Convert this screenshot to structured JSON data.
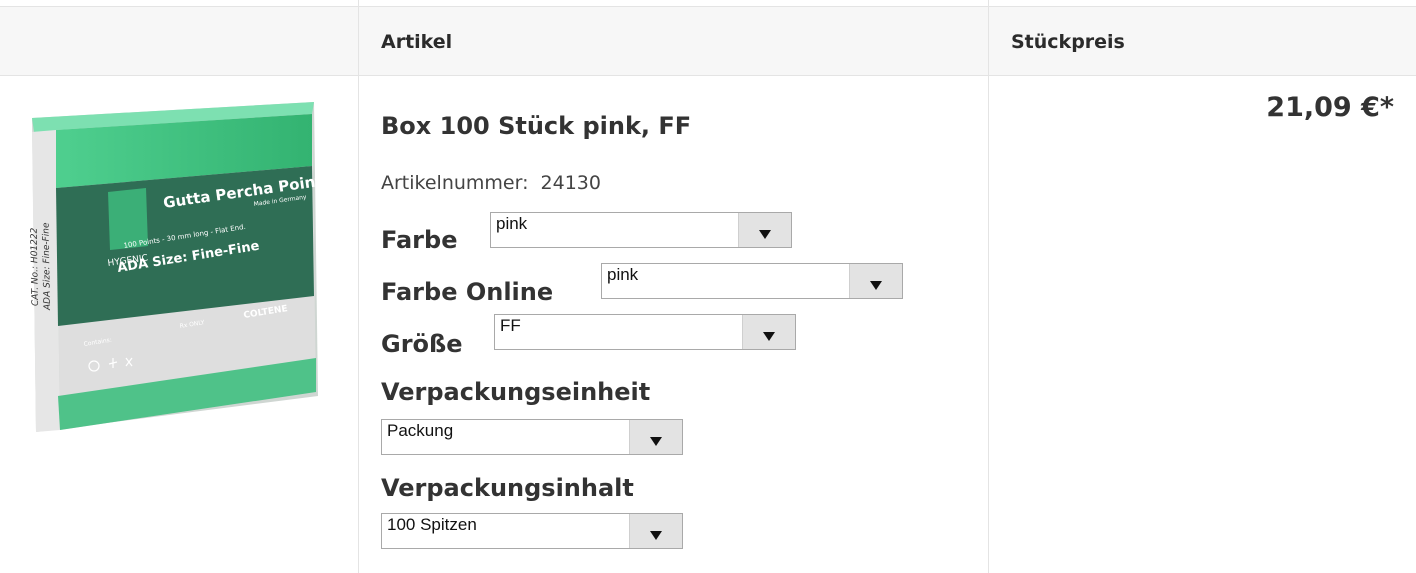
{
  "table": {
    "col_article": "Artikel",
    "col_price": "Stückpreis"
  },
  "product": {
    "image_label": {
      "brand": "HYGENIC",
      "name": "Gutta Percha Points",
      "made_in": "Made in Germany",
      "spec": "100 Points - 30 mm long - Flat End.",
      "size": "ADA Size: Fine-Fine",
      "cat": "CAT. No.: H01222",
      "side_size": "ADA Size: Fine-Fine",
      "rx": "Rx ONLY",
      "maker": "COLTENE",
      "contains": "Contains:"
    },
    "title": "Box 100 Stück pink, FF",
    "artnr_label": "Artikelnummer:",
    "artnr_value": "24130",
    "price": "21,09 €*"
  },
  "options": {
    "farbe": {
      "label": "Farbe",
      "value": "pink"
    },
    "farbe_online": {
      "label": "Farbe Online",
      "value": "pink"
    },
    "groesse": {
      "label": "Größe",
      "value": "FF"
    },
    "verpackungseinheit": {
      "label": "Verpackungseinheit",
      "value": "Packung"
    },
    "verpackungsinhalt": {
      "label": "Verpackungsinhalt",
      "value": "100 Spitzen"
    }
  },
  "colors": {
    "box_green": "#3fbf7f",
    "box_dark": "#2e6b55",
    "box_grey": "#dcdcdc"
  },
  "icons": [
    "chevron-down-icon"
  ]
}
